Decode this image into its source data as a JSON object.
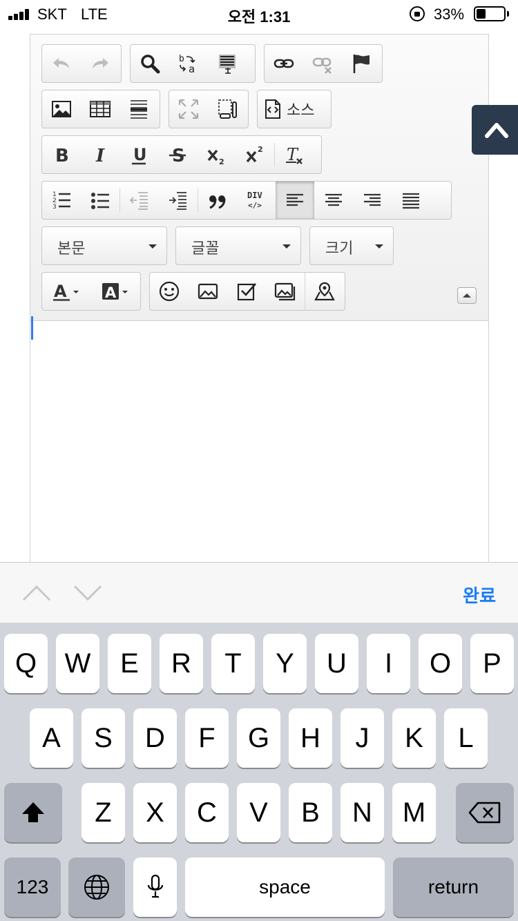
{
  "status_bar": {
    "carrier": "SKT",
    "network": "LTE",
    "time": "오전 1:31",
    "battery_percent": "33%",
    "battery_level": 0.33
  },
  "toolbar": {
    "source_label": "소스",
    "format_combo": "본문",
    "font_combo": "글꼴",
    "size_combo": "크기"
  },
  "accessory": {
    "done_label": "완료"
  },
  "keyboard": {
    "row1": [
      "Q",
      "W",
      "E",
      "R",
      "T",
      "Y",
      "U",
      "I",
      "O",
      "P"
    ],
    "row2": [
      "A",
      "S",
      "D",
      "F",
      "G",
      "H",
      "J",
      "K",
      "L"
    ],
    "row3": [
      "Z",
      "X",
      "C",
      "V",
      "B",
      "N",
      "M"
    ],
    "numbers_key": "123",
    "space_key": "space",
    "return_key": "return"
  },
  "colors": {
    "accent": "#1a7cf5",
    "caret": "#3478f6",
    "scroll_top_bg": "#2b3a4d",
    "keyboard_bg": "#d1d4da",
    "function_key_bg": "#abb0ba"
  }
}
